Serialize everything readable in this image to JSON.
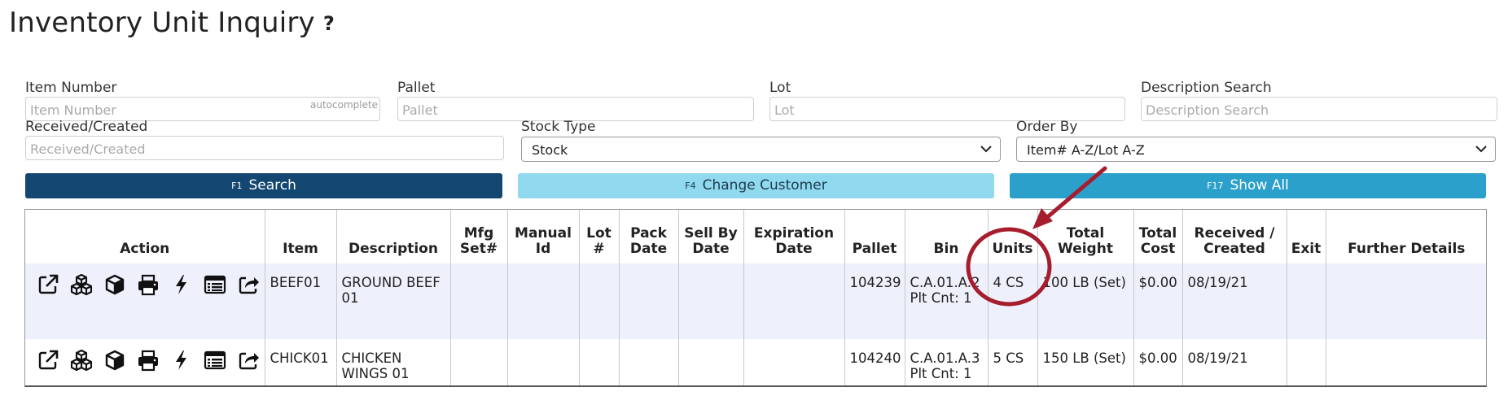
{
  "page": {
    "title": "Inventory Unit Inquiry",
    "help": "?"
  },
  "filters": {
    "item_number": {
      "label": "Item Number",
      "placeholder": "Item Number",
      "hint": "autocomplete"
    },
    "pallet": {
      "label": "Pallet",
      "placeholder": "Pallet"
    },
    "lot": {
      "label": "Lot",
      "placeholder": "Lot"
    },
    "description": {
      "label": "Description Search",
      "placeholder": "Description Search"
    },
    "received": {
      "label": "Received/Created",
      "placeholder": "Received/Created"
    },
    "stock_type": {
      "label": "Stock Type",
      "value": "Stock"
    },
    "order_by": {
      "label": "Order By",
      "value": "Item# A-Z/Lot A-Z"
    }
  },
  "buttons": {
    "search": {
      "key": "F1",
      "label": "Search"
    },
    "change_customer": {
      "key": "F4",
      "label": "Change Customer"
    },
    "show_all": {
      "key": "F17",
      "label": "Show All"
    }
  },
  "table": {
    "headers": {
      "action": "Action",
      "item": "Item",
      "description": "Description",
      "mfg_set": "Mfg Set#",
      "manual_id": "Manual Id",
      "lot": "Lot #",
      "pack_date": "Pack Date",
      "sell_by": "Sell By Date",
      "expiration": "Expiration Date",
      "pallet": "Pallet",
      "bin": "Bin",
      "units": "Units",
      "total_weight": "Total Weight",
      "total_cost": "Total Cost",
      "received": "Received / Created",
      "exit": "Exit",
      "further": "Further Details"
    },
    "action_icons": [
      "external-link-icon",
      "boxes-icon",
      "box-icon",
      "print-icon",
      "bolt-icon",
      "list-icon",
      "share-icon"
    ],
    "rows": [
      {
        "item": "BEEF01",
        "description": "GROUND BEEF 01",
        "mfg_set": "",
        "manual_id": "",
        "lot": "",
        "pack_date": "",
        "sell_by": "",
        "expiration": "",
        "pallet": "104239",
        "bin": "C.A.01.A.2",
        "plt_cnt": "Plt Cnt: 1",
        "units": "4 CS",
        "total_weight": "100 LB (Set)",
        "total_cost": "$0.00",
        "received": "08/19/21",
        "exit": "",
        "further": ""
      },
      {
        "item": "CHICK01",
        "description": "CHICKEN WINGS 01",
        "mfg_set": "",
        "manual_id": "",
        "lot": "",
        "pack_date": "",
        "sell_by": "",
        "expiration": "",
        "pallet": "104240",
        "bin": "C.A.01.A.3",
        "plt_cnt": "Plt Cnt: 1",
        "units": "5 CS",
        "total_weight": "150 LB (Set)",
        "total_cost": "$0.00",
        "received": "08/19/21",
        "exit": "",
        "further": ""
      }
    ]
  },
  "colors": {
    "search_button": "#134670",
    "customer_button": "#90d9ee",
    "show_all_button": "#2aa0cb",
    "row_highlight": "#eef0fc",
    "annotation": "#a61d2d"
  }
}
